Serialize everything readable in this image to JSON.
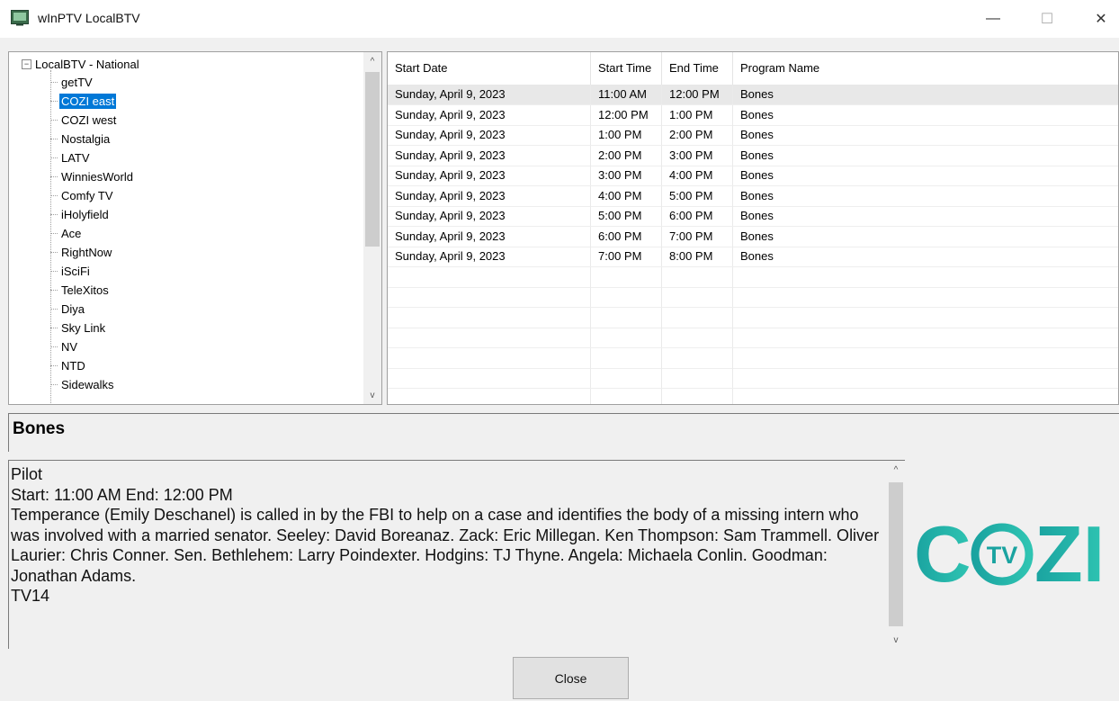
{
  "window": {
    "title": "wInPTV LocalBTV",
    "minimize_glyph": "—",
    "maximize_glyph": "☐",
    "close_glyph": "✕"
  },
  "tree": {
    "root_label": "LocalBTV - National",
    "toggle_glyph": "−",
    "items": [
      {
        "label": "getTV",
        "selected": false
      },
      {
        "label": "COZI east",
        "selected": true
      },
      {
        "label": "COZI west",
        "selected": false
      },
      {
        "label": "Nostalgia",
        "selected": false
      },
      {
        "label": "LATV",
        "selected": false
      },
      {
        "label": "WinniesWorld",
        "selected": false
      },
      {
        "label": "Comfy TV",
        "selected": false
      },
      {
        "label": "iHolyfield",
        "selected": false
      },
      {
        "label": "Ace",
        "selected": false
      },
      {
        "label": "RightNow",
        "selected": false
      },
      {
        "label": "iSciFi",
        "selected": false
      },
      {
        "label": "TeleXitos",
        "selected": false
      },
      {
        "label": "Diya",
        "selected": false
      },
      {
        "label": "Sky Link",
        "selected": false
      },
      {
        "label": "NV",
        "selected": false
      },
      {
        "label": "NTD",
        "selected": false
      },
      {
        "label": "Sidewalks",
        "selected": false
      }
    ],
    "scroll_up_glyph": "^",
    "scroll_down_glyph": "v"
  },
  "schedule": {
    "columns": [
      "Start Date",
      "Start Time",
      "End Time",
      "Program Name"
    ],
    "rows": [
      [
        "Sunday, April 9, 2023",
        "11:00 AM",
        "12:00 PM",
        "Bones"
      ],
      [
        "Sunday, April 9, 2023",
        "12:00 PM",
        "1:00 PM",
        "Bones"
      ],
      [
        "Sunday, April 9, 2023",
        "1:00 PM",
        "2:00 PM",
        "Bones"
      ],
      [
        "Sunday, April 9, 2023",
        "2:00 PM",
        "3:00 PM",
        "Bones"
      ],
      [
        "Sunday, April 9, 2023",
        "3:00 PM",
        "4:00 PM",
        "Bones"
      ],
      [
        "Sunday, April 9, 2023",
        "4:00 PM",
        "5:00 PM",
        "Bones"
      ],
      [
        "Sunday, April 9, 2023",
        "5:00 PM",
        "6:00 PM",
        "Bones"
      ],
      [
        "Sunday, April 9, 2023",
        "6:00 PM",
        "7:00 PM",
        "Bones"
      ],
      [
        "Sunday, April 9, 2023",
        "7:00 PM",
        "8:00 PM",
        "Bones"
      ]
    ],
    "selected_row": 0,
    "empty_rows": 7
  },
  "program": {
    "title": "Bones",
    "description_lines": [
      "Pilot",
      "Start: 11:00 AM  End: 12:00 PM",
      "Temperance (Emily Deschanel) is called in by the FBI to help on a case and identifies the body of a missing intern who was involved with a married senator. Seeley: David Boreanaz. Zack: Eric Millegan. Ken Thompson: Sam Trammell. Oliver Laurier: Chris Conner. Sen. Bethlehem: Larry Poindexter. Hodgins: TJ Thyne. Angela: Michaela Conlin. Goodman: Jonathan Adams.",
      "TV14"
    ]
  },
  "logo": {
    "text_left": "C",
    "text_right": "ZI",
    "badge_text": "TV",
    "colors": {
      "start": "#1aa3a0",
      "end": "#2fc4b2"
    }
  },
  "buttons": {
    "close_label": "Close"
  },
  "colors": {
    "selection": "#0078d7",
    "row_selection": "#e8e8e8",
    "window_bg": "#f0f0f0"
  }
}
